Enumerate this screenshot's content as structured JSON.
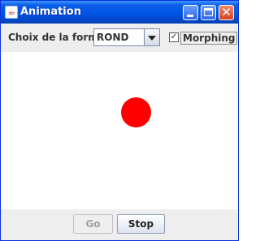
{
  "window": {
    "title": "Animation"
  },
  "toolbar": {
    "shape_label": "Choix de la forme",
    "shape_selected": "ROND",
    "morphing_label": "Morphing",
    "morphing_checked": true
  },
  "canvas": {
    "shape_color": "#ff0000"
  },
  "buttons": {
    "go_label": "Go",
    "stop_label": "Stop"
  },
  "icons": {
    "app": "java-icon",
    "minimize": "minimize-icon",
    "maximize": "maximize-icon",
    "close": "close-icon",
    "dropdown": "chevron-down-icon",
    "check": "check-icon"
  }
}
